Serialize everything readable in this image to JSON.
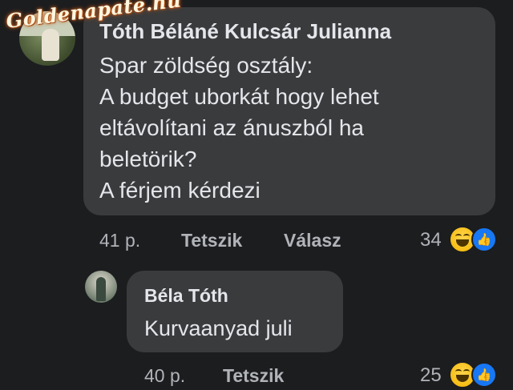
{
  "watermark": "Goldenapate.hu",
  "comment1": {
    "author": "Tóth Béláné Kulcsár Julianna",
    "lines": [
      "Spar zöldség osztály:",
      "A budget uborkát hogy lehet",
      "eltávolítani az ánuszból ha",
      "beletörik?",
      "A férjem kérdezi"
    ],
    "time": "41 p.",
    "like_label": "Tetszik",
    "reply_label": "Válasz",
    "reaction_count": "34",
    "reaction_icons": [
      "haha-icon",
      "like-icon"
    ]
  },
  "comment2": {
    "author": "Béla Tóth",
    "text": "Kurvaanyad juli",
    "time": "40 p.",
    "like_label": "Tetszik",
    "reaction_count": "25",
    "reaction_icons": [
      "haha-icon",
      "like-icon"
    ]
  }
}
